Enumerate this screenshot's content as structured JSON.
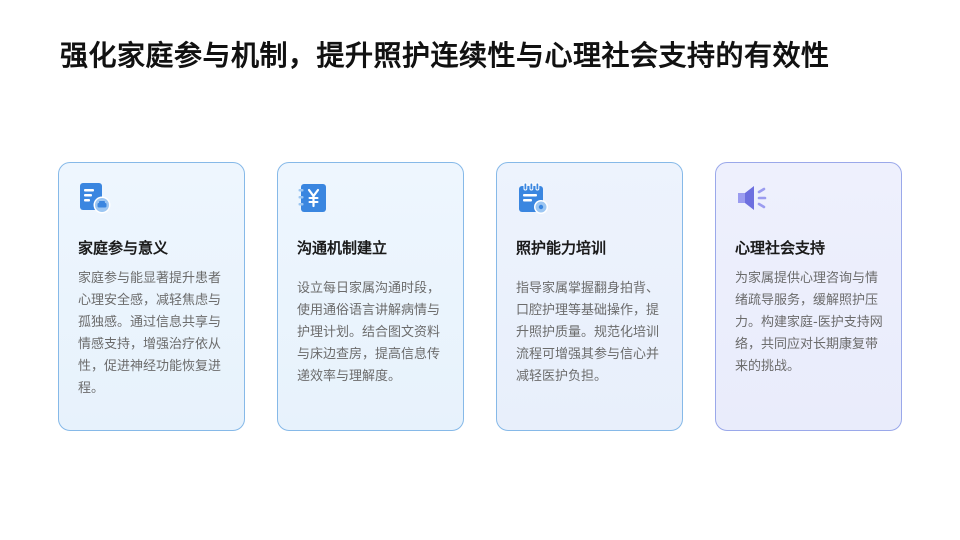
{
  "title": "强化家庭参与机制，提升照护连续性与心理社会支持的有效性",
  "cards": [
    {
      "icon": "document-car-icon",
      "title": "家庭参与意义",
      "body": "家庭参与能显著提升患者心理安全感，减轻焦虑与孤独感。通过信息共享与情感支持，增强治疗依从性，促进神经功能恢复进程。"
    },
    {
      "icon": "yuan-notebook-icon",
      "title": "沟通机制建立",
      "body": "设立每日家属沟通时段，使用通俗语言讲解病情与护理计划。结合图文资料与床边查房，提高信息传递效率与理解度。"
    },
    {
      "icon": "calendar-clipboard-icon",
      "title": "照护能力培训",
      "body": "指导家属掌握翻身拍背、口腔护理等基础操作，提升照护质量。规范化培训流程可增强其参与信心并减轻医护负担。"
    },
    {
      "icon": "speaker-icon",
      "title": "心理社会支持",
      "body": "为家属提供心理咨询与情绪疏导服务，缓解照护压力。构建家庭-医护支持网络，共同应对长期康复带来的挑战。"
    }
  ],
  "colors": {
    "icon_blue": "#3a86e0",
    "icon_purple": "#6d6fdf",
    "border": "#86b9e8"
  }
}
